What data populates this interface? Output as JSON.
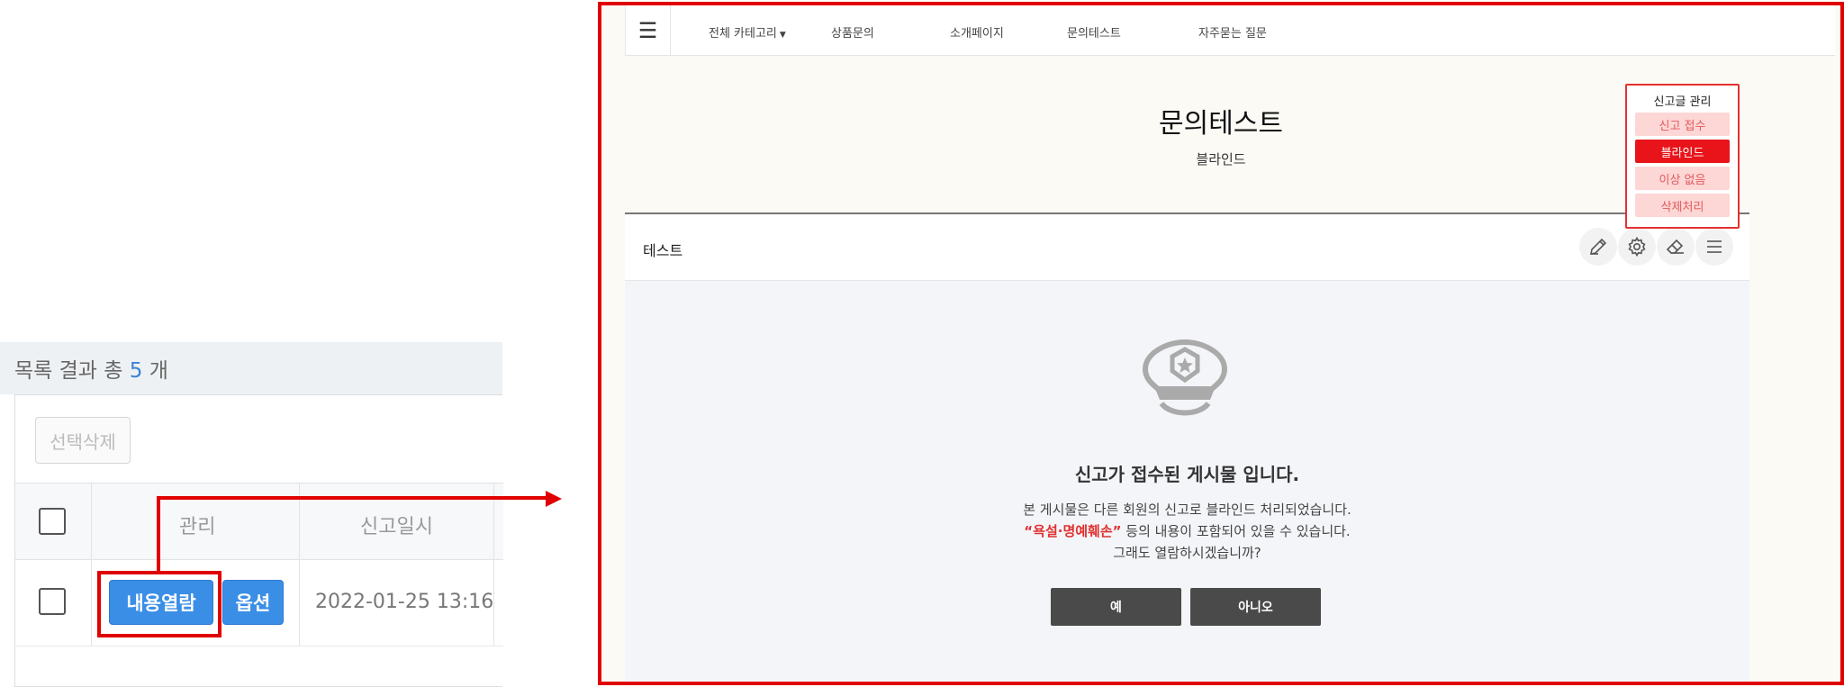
{
  "left": {
    "result_prefix": "목록 결과 총",
    "result_count": "5",
    "result_suffix": "개",
    "select_delete": "선택삭제",
    "headers": {
      "manage": "관리",
      "report_date": "신고일시"
    },
    "row": {
      "open_button": "내용열람",
      "option_button": "옵션",
      "date": "2022-01-25 13:16"
    }
  },
  "site": {
    "nav": {
      "menu_icon": "☰",
      "items": [
        {
          "label": "전체 카테고리",
          "dropdown": true
        },
        {
          "label": "상품문의"
        },
        {
          "label": "소개페이지"
        },
        {
          "label": "문의테스트"
        },
        {
          "label": "자주묻는 질문"
        }
      ]
    },
    "page_title": "문의테스트",
    "page_subtitle": "블라인드",
    "board_title": "테스트",
    "tools": [
      "pencil-icon",
      "gear-icon",
      "eraser-icon",
      "menu-icon"
    ],
    "report_panel": {
      "title": "신고글 관리",
      "options": [
        {
          "label": "신고 접수",
          "state": "inactive"
        },
        {
          "label": "블라인드",
          "state": "active"
        },
        {
          "label": "이상 없음",
          "state": "inactive"
        },
        {
          "label": "삭제처리",
          "state": "inactive"
        }
      ]
    },
    "notice": {
      "title": "신고가 접수된 게시물 입니다.",
      "line1": "본 게시물은 다른 회원의 신고로 블라인드 처리되었습니다.",
      "line2_highlight": "“욕설·명예훼손”",
      "line2_rest": " 등의 내용이 포함되어 있을 수 있습니다.",
      "line3": "그래도 열람하시겠습니까?",
      "yes": "예",
      "no": "아니오"
    }
  },
  "colors": {
    "highlight_red": "#e00000",
    "button_blue": "#3a8ee6",
    "dark_button": "#4a4a4a"
  }
}
